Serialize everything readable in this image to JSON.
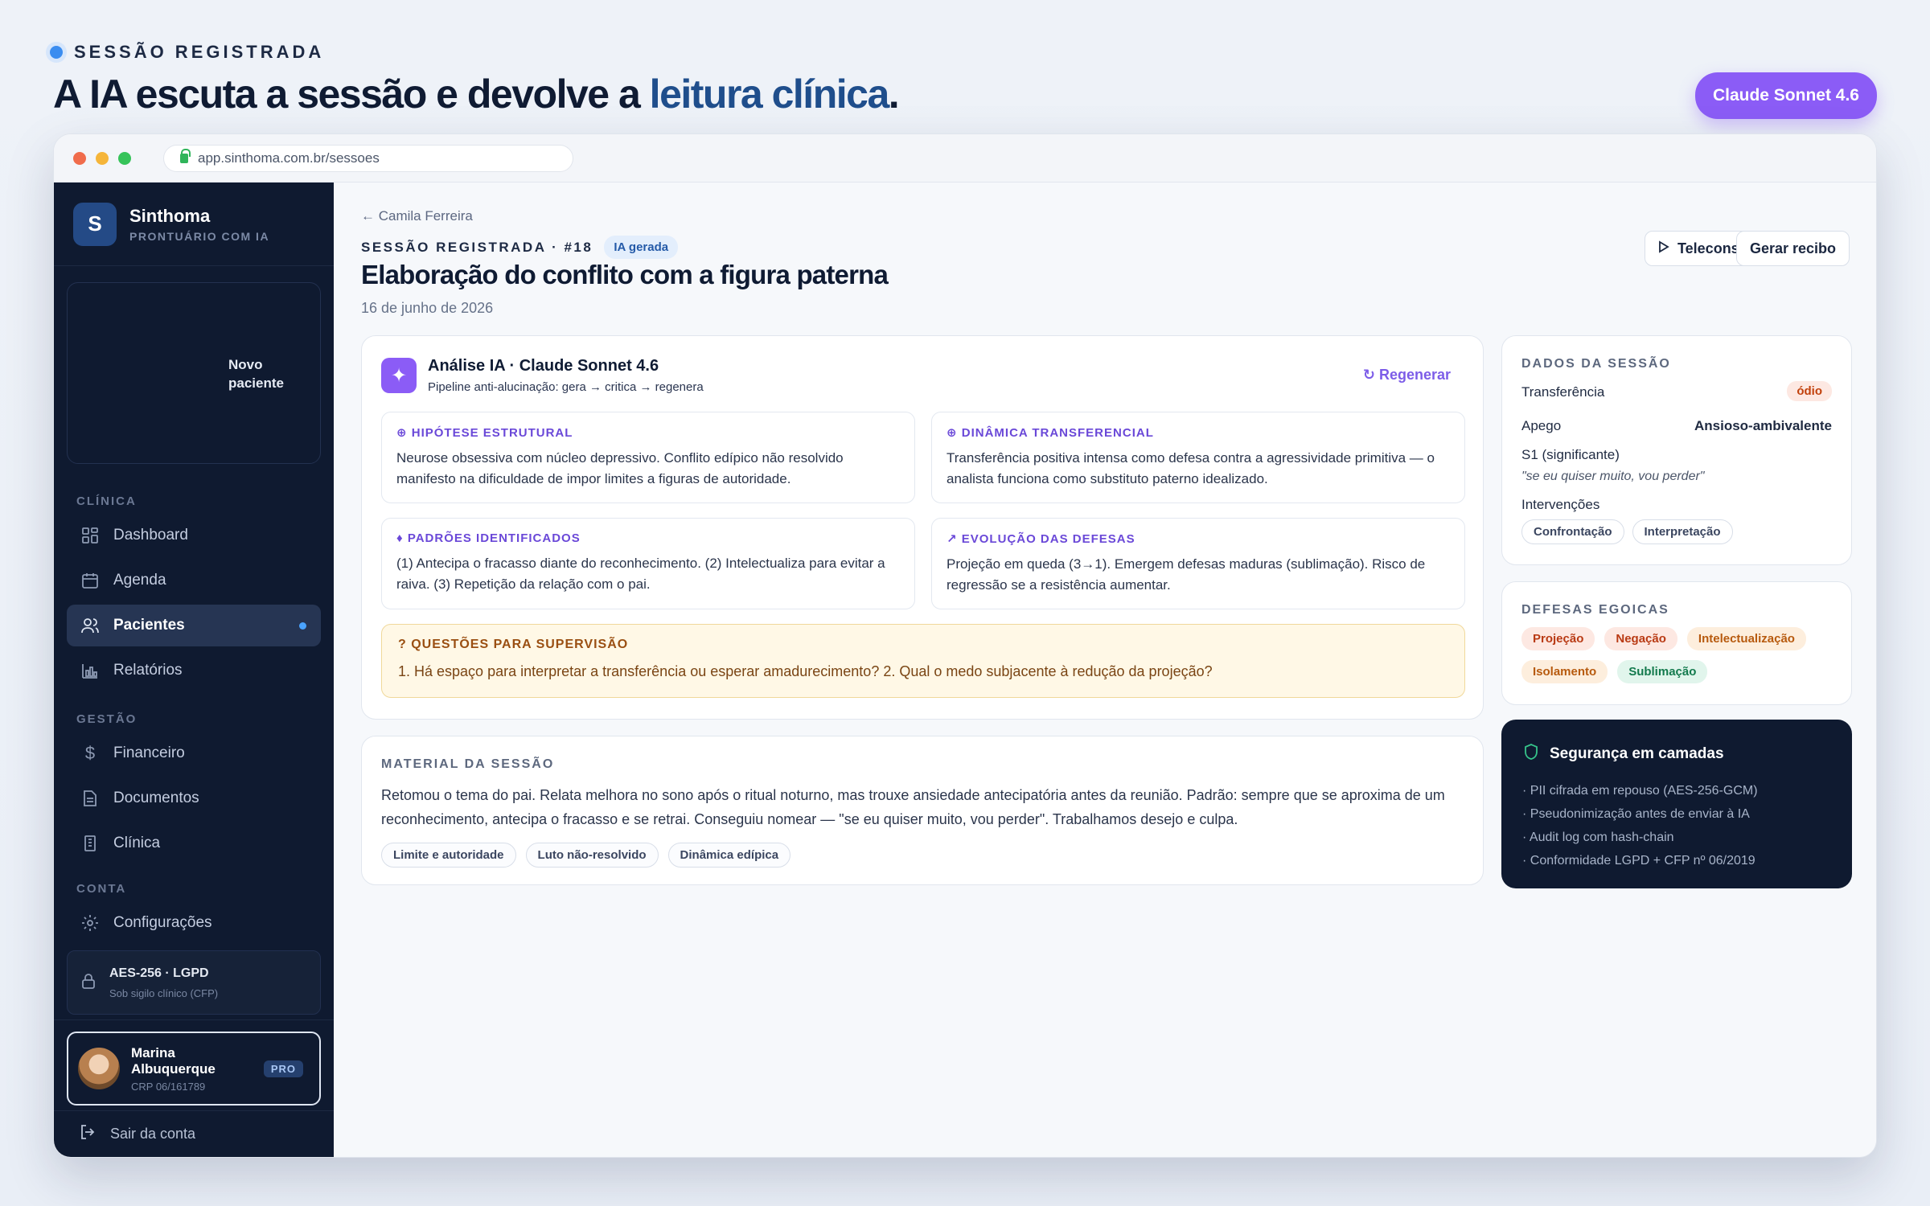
{
  "hero": {
    "eyebrow": "SESSÃO REGISTRADA",
    "title_prefix": "A IA escuta a sessão e devolve a ",
    "title_accent": "leitura clínica",
    "title_suffix": ".",
    "model_pill": "Claude Sonnet 4.6"
  },
  "browser": {
    "url": "app.sinthoma.com.br/sessoes"
  },
  "sidebar": {
    "brand_letter": "S",
    "brand_name": "Sinthoma",
    "brand_sub": "PRONTUÁRIO COM IA",
    "new_patient": "Novo paciente",
    "sections": {
      "clinica": "CLÍNICA",
      "gestao": "GESTÃO",
      "conta": "CONTA"
    },
    "items": {
      "dashboard": "Dashboard",
      "agenda": "Agenda",
      "pacientes": "Pacientes",
      "relatorios": "Relatórios",
      "financeiro": "Financeiro",
      "documentos": "Documentos",
      "clinica": "Clínica",
      "configuracoes": "Configurações"
    },
    "security": {
      "title": "AES-256 · LGPD",
      "subtitle": "Sob sigilo clínico (CFP)"
    },
    "profile": {
      "name": "Marina Albuquerque",
      "crp": "CRP 06/161789",
      "badge": "PRO"
    },
    "logout": "Sair da conta"
  },
  "main": {
    "back": "← Camila Ferreira",
    "session_label": "SESSÃO REGISTRADA · #18",
    "ia_badge": "IA gerada",
    "title": "Elaboração do conflito com a figura paterna",
    "date": "16 de junho de 2026",
    "btn_tele": "Teleconsulta",
    "btn_recibo": "Gerar recibo"
  },
  "analysis": {
    "title": "Análise IA · Claude Sonnet 4.6",
    "subtitle": "Pipeline anti-alucinação: gera → critica → regenera",
    "regen": "Regenerar",
    "hipotese_title": "HIPÓTESE ESTRUTURAL",
    "hipotese_text": "Neurose obsessiva com núcleo depressivo. Conflito edípico não resolvido manifesto na dificuldade de impor limites a figuras de autoridade.",
    "dinamica_title": "DINÂMICA TRANSFERENCIAL",
    "dinamica_text": "Transferência positiva intensa como defesa contra a agressividade primitiva — o analista funciona como substituto paterno idealizado.",
    "padroes_title": "PADRÕES IDENTIFICADOS",
    "padroes_text": "(1) Antecipa o fracasso diante do reconhecimento. (2) Intelectualiza para evitar a raiva. (3) Repetição da relação com o pai.",
    "evolucao_title": "EVOLUÇÃO DAS DEFESAS",
    "evolucao_text": "Projeção em queda (3→1). Emergem defesas maduras (sublimação). Risco de regressão se a resistência aumentar.",
    "supervisao_title": "? QUESTÕES PARA SUPERVISÃO",
    "supervisao_text": "1. Há espaço para interpretar a transferência ou esperar amadurecimento? 2. Qual o medo subjacente à redução da projeção?"
  },
  "material": {
    "label": "MATERIAL DA SESSÃO",
    "text": "Retomou o tema do pai. Relata melhora no sono após o ritual noturno, mas trouxe ansiedade antecipatória antes da reunião. Padrão: sempre que se aproxima de um reconhecimento, antecipa o fracasso e se retrai. Conseguiu nomear — \"se eu quiser muito, vou perder\". Trabalhamos desejo e culpa.",
    "tags": [
      "Limite e autoridade",
      "Luto não-resolvido",
      "Dinâmica edípica"
    ]
  },
  "dados": {
    "label": "DADOS DA SESSÃO",
    "transferencia_k": "Transferência",
    "transferencia_v": "ódio",
    "apego_k": "Apego",
    "apego_v": "Ansioso-ambivalente",
    "s1_k": "S1 (significante)",
    "s1_v": "\"se eu quiser muito, vou perder\"",
    "intervencoes_k": "Intervenções",
    "intervencoes": [
      "Confrontação",
      "Interpretação"
    ]
  },
  "defesas": {
    "label": "DEFESAS EGOICAS",
    "items": [
      "Projeção",
      "Negação",
      "Intelectualização",
      "Isolamento",
      "Sublimação"
    ]
  },
  "seguranca": {
    "title": "Segurança em camadas",
    "items": [
      "· PII cifrada em repouso (AES-256-GCM)",
      "· Pseudonimização antes de enviar à IA",
      "· Audit log com hash-chain",
      "· Conformidade LGPD + CFP nº 06/2019"
    ]
  }
}
